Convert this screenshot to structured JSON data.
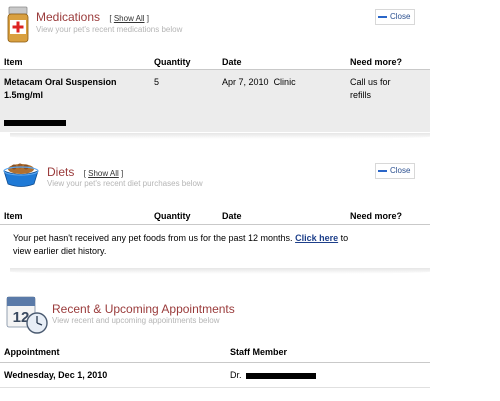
{
  "colors": {
    "title": "#9a3b3b",
    "subtitle": "#b5b5b5",
    "accent": "#2a66c8",
    "row_bg": "#ececec"
  },
  "medications": {
    "icon": "medicine-bottle-icon",
    "title": "Medications",
    "show_all": "Show All",
    "subtitle": "View your pet's recent medications below",
    "close_label": "Close",
    "columns": [
      "Item",
      "Quantity",
      "Date",
      "Need more?"
    ],
    "row": {
      "item_line1": "Metacam Oral Suspension",
      "item_line2": "1.5mg/ml",
      "quantity": "5",
      "date": "Apr 7, 2010",
      "source": "Clinic",
      "need_more_line1": "Call us for",
      "need_more_line2": "refills"
    }
  },
  "diets": {
    "icon": "food-bowl-icon",
    "title": "Diets",
    "show_all": "Show All",
    "subtitle": "View your pet's recent diet purchases below",
    "close_label": "Close",
    "columns": [
      "Item",
      "Quantity",
      "Date",
      "Need more?"
    ],
    "message_before": "Your pet hasn't received any pet foods from us for the past 12 months.",
    "message_link": "Click here",
    "message_after": "to",
    "message_line2": "view earlier diet history."
  },
  "appointments": {
    "icon": "calendar-clock-icon",
    "calendar_number": "12",
    "title": "Recent & Upcoming Appointments",
    "subtitle": "View recent and upcoming appointments below",
    "columns": [
      "Appointment",
      "Staff Member"
    ],
    "row": {
      "appointment": "Wednesday, Dec 1, 2010",
      "staff_prefix": "Dr."
    }
  }
}
